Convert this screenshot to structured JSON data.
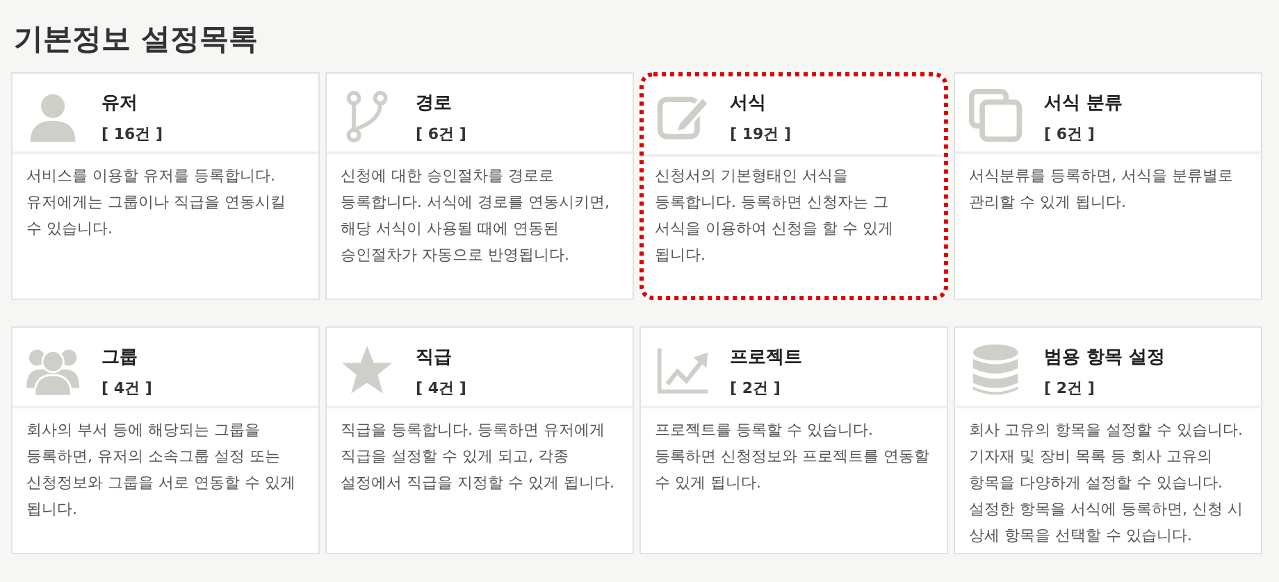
{
  "page_title": "기본정보 설정목록",
  "cards": [
    {
      "title": "유저",
      "count": "[ 16건 ]",
      "description": "서비스를 이용할 유저를 등록합니다. 유저에게는 그룹이나 직급을 연동시킬 수 있습니다.",
      "selected": false
    },
    {
      "title": "경로",
      "count": "[ 6건 ]",
      "description": "신청에 대한 승인절차를 경로로 등록합니다. 서식에 경로를 연동시키면, 해당 서식이 사용될 때에 연동된 승인절차가 자동으로 반영됩니다.",
      "selected": false
    },
    {
      "title": "서식",
      "count": "[ 19건 ]",
      "description": "신청서의 기본형태인 서식을 등록합니다. 등록하면 신청자는 그 서식을 이용하여 신청을 할 수 있게 됩니다.",
      "selected": true
    },
    {
      "title": "서식 분류",
      "count": "[ 6건 ]",
      "description": "서식분류를 등록하면, 서식을 분류별로 관리할 수 있게 됩니다.",
      "selected": false
    },
    {
      "title": "그룹",
      "count": "[ 4건 ]",
      "description": "회사의 부서 등에 해당되는 그룹을 등록하면, 유저의 소속그룹 설정 또는 신청정보와 그룹을 서로 연동할 수 있게 됩니다.",
      "selected": false
    },
    {
      "title": "직급",
      "count": "[ 4건 ]",
      "description": "직급을 등록합니다. 등록하면 유저에게 직급을 설정할 수 있게 되고, 각종 설정에서 직급을 지정할 수 있게 됩니다.",
      "selected": false
    },
    {
      "title": "프로젝트",
      "count": "[ 2건 ]",
      "description": "프로젝트를 등록할 수 있습니다. 등록하면 신청정보와 프로젝트를 연동할 수 있게 됩니다.",
      "selected": false
    },
    {
      "title": "범용 항목 설정",
      "count": "[ 2건 ]",
      "description": "회사 고유의 항목을 설정할 수 있습니다. 기자재 및 장비 목록 등 회사 고유의 항목을 다양하게 설정할 수 있습니다. 설정한 항목을 서식에 등록하면, 신청 시 상세 항목을 선택할 수 있습니다.",
      "selected": false
    }
  ]
}
